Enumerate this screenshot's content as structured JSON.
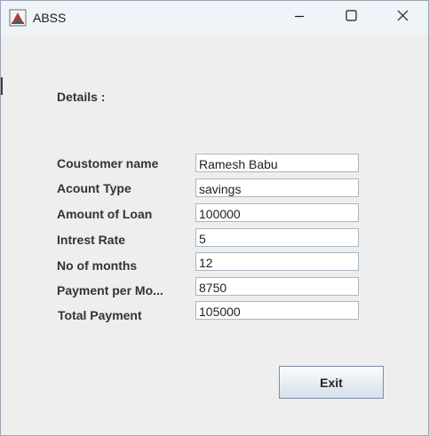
{
  "window": {
    "title": "ABSS",
    "icon": "java-app-icon"
  },
  "titlebar_buttons": {
    "minimize": "minimize-icon",
    "maximize": "maximize-icon",
    "close": "close-icon"
  },
  "details_heading": "Details :",
  "fields": [
    {
      "label": "Coustomer name",
      "value": "Ramesh Babu"
    },
    {
      "label": "Acount Type",
      "value": "savings"
    },
    {
      "label": "Amount of Loan",
      "value": "100000"
    },
    {
      "label": "Intrest Rate",
      "value": "5"
    },
    {
      "label": "No of months",
      "value": "12"
    },
    {
      "label": "Payment per Mo...",
      "value": "8750"
    },
    {
      "label": "Total Payment",
      "value": "105000"
    }
  ],
  "exit_label": "Exit"
}
